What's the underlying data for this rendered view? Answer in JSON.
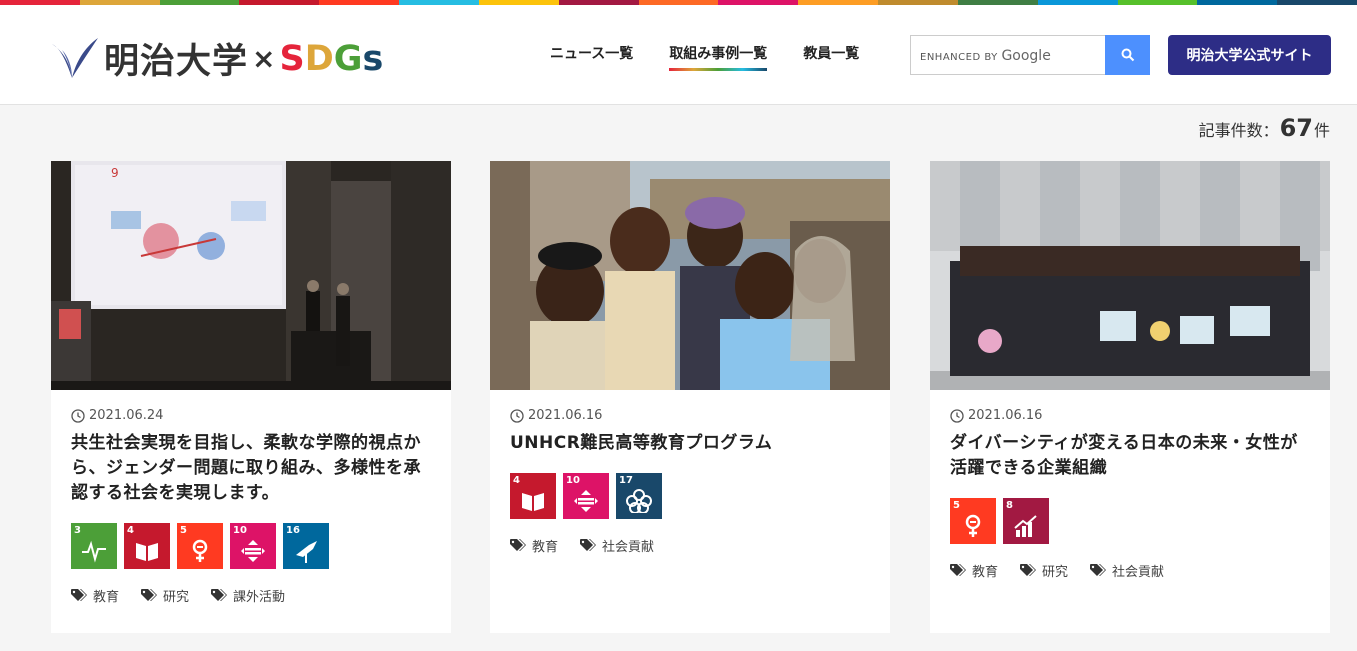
{
  "rainbow": [
    "#e5243b",
    "#dda63a",
    "#4c9f38",
    "#c5192d",
    "#ff3a21",
    "#26bde2",
    "#fcc30b",
    "#a21942",
    "#fd6925",
    "#dd1367",
    "#fd9d24",
    "#bf8b2e",
    "#3f7e44",
    "#0a97d9",
    "#56c02b",
    "#00689d",
    "#19486a"
  ],
  "header": {
    "logo_main": "明治大学",
    "logo_x": "×",
    "logo_sdgs": [
      "S",
      "D",
      "G",
      "s"
    ],
    "nav": [
      "ニュース一覧",
      "取組み事例一覧",
      "教員一覧"
    ],
    "search_brand_prefix": "ENHANCED BY",
    "search_brand_name": "Google",
    "official_label": "明治大学公式サイト"
  },
  "count": {
    "label": "記事件数：",
    "value": "67",
    "unit": "件"
  },
  "cards": [
    {
      "date": "2021.06.24",
      "title": "共生社会実現を目指し、柔軟な学際的視点から、ジェンダー問題に取り組み、多様性を承認する社会を実現します。",
      "goals": [
        {
          "num": "3",
          "color": "#4c9f38",
          "icon": "health-pulse-icon"
        },
        {
          "num": "4",
          "color": "#c5192d",
          "icon": "book-icon"
        },
        {
          "num": "5",
          "color": "#ff3a21",
          "icon": "gender-icon"
        },
        {
          "num": "10",
          "color": "#dd1367",
          "icon": "equality-icon"
        },
        {
          "num": "16",
          "color": "#00689d",
          "icon": "dove-icon"
        }
      ],
      "tags": [
        "教育",
        "研究",
        "課外活動"
      ]
    },
    {
      "date": "2021.06.16",
      "title": "UNHCR難民高等教育プログラム",
      "goals": [
        {
          "num": "4",
          "color": "#c5192d",
          "icon": "book-icon"
        },
        {
          "num": "10",
          "color": "#dd1367",
          "icon": "equality-icon"
        },
        {
          "num": "17",
          "color": "#19486a",
          "icon": "partnership-icon"
        }
      ],
      "tags": [
        "教育",
        "社会貢献"
      ]
    },
    {
      "date": "2021.06.16",
      "title": "ダイバーシティが変える日本の未来・女性が活躍できる企業組織",
      "goals": [
        {
          "num": "5",
          "color": "#ff3a21",
          "icon": "gender-icon"
        },
        {
          "num": "8",
          "color": "#a21942",
          "icon": "growth-chart-icon"
        }
      ],
      "tags": [
        "教育",
        "研究",
        "社会貢献"
      ]
    }
  ]
}
